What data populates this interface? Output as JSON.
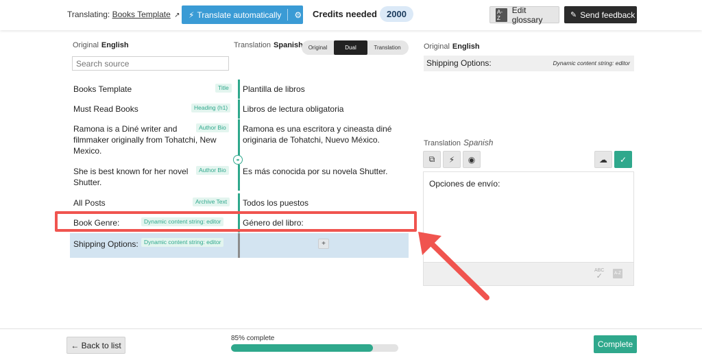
{
  "header": {
    "translating_label": "Translating:",
    "document_name": "Books Template",
    "translate_button": "Translate automatically",
    "credits_label": "Credits needed",
    "credits_value": "2000",
    "glossary_button": "Edit glossary",
    "feedback_button": "Send feedback"
  },
  "source_column": {
    "label": "Original",
    "language": "English",
    "search_placeholder": "Search source"
  },
  "target_column": {
    "label": "Translation",
    "language": "Spanish"
  },
  "view_toggle": {
    "options": [
      "Original",
      "Dual",
      "Translation"
    ],
    "selected": "Dual"
  },
  "rows": [
    {
      "source": "Books Template",
      "tag": "Title",
      "target": "Plantilla de libros"
    },
    {
      "source": "Must Read Books",
      "tag": "Heading (h1)",
      "target": "Libros de lectura obligatoria"
    },
    {
      "source_lines": [
        "Ramona is a Diné writer and",
        "filmmaker originally from Tohatchi, New",
        "Mexico."
      ],
      "tag": "Author Bio",
      "target_lines": [
        "Ramona es una escritora y cineasta diné",
        "originaria de Tohatchi, Nuevo México."
      ]
    },
    {
      "source_lines": [
        "She is best known for her novel",
        "Shutter."
      ],
      "tag": "Author Bio",
      "target": "Es más conocida por su novela Shutter."
    },
    {
      "source": "All Posts",
      "tag": "Archive Text",
      "target": "Todos los puestos"
    },
    {
      "source": "Book Genre:",
      "tag": "Dynamic content string: editor",
      "target": "Género del libro:"
    },
    {
      "source": "Shipping Options:",
      "tag": "Dynamic content string: editor",
      "target": ""
    }
  ],
  "right_panel": {
    "original_label": "Original",
    "original_language": "English",
    "original_value": "Shipping Options:",
    "original_tag": "Dynamic content string: editor",
    "translation_label": "Translation",
    "translation_language": "Spanish",
    "editor_text": "Opciones de envío:",
    "spellcheck_label": "ABC"
  },
  "footer": {
    "back_button": "← Back to list",
    "progress_label": "85% complete",
    "progress_fraction": 0.85,
    "complete_button": "Complete"
  },
  "colors": {
    "accent_green": "#2fa88c",
    "translate_blue": "#3a9bd5",
    "highlight_red": "#f0544f",
    "selected_row": "#d3e4f1"
  }
}
